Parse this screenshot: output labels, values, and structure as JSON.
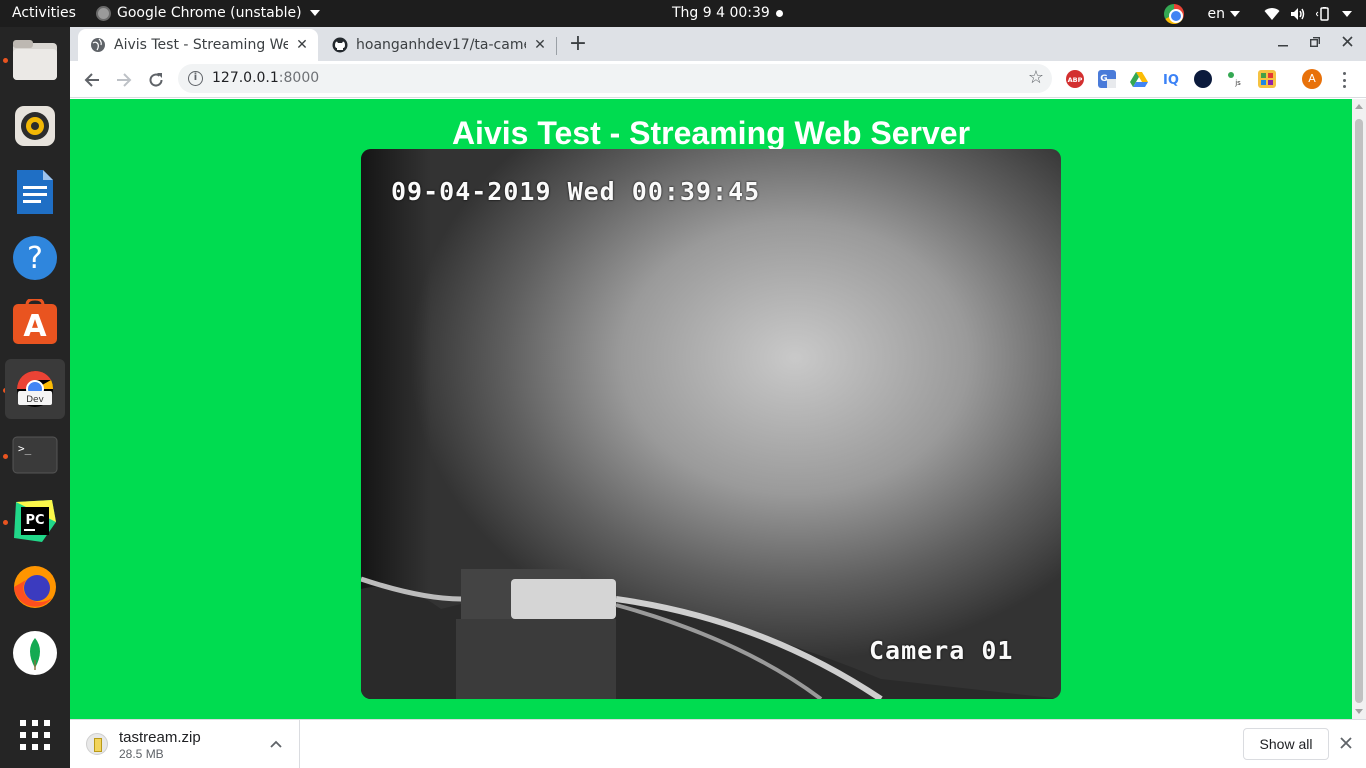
{
  "system_bar": {
    "activities": "Activities",
    "app_name": "Google Chrome (unstable)",
    "clock": "Thg 9 4  00:39",
    "language": "en"
  },
  "dock": {
    "items": [
      {
        "name": "files-icon",
        "running": true
      },
      {
        "name": "rhythmbox-icon",
        "running": false
      },
      {
        "name": "libreoffice-writer-icon",
        "running": false
      },
      {
        "name": "help-icon",
        "running": false
      },
      {
        "name": "software-center-icon",
        "running": false
      },
      {
        "name": "chrome-dev-icon",
        "running": true,
        "label": "Dev"
      },
      {
        "name": "terminal-icon",
        "running": true
      },
      {
        "name": "pycharm-icon",
        "running": true,
        "label": "PC"
      },
      {
        "name": "firefox-icon",
        "running": false
      },
      {
        "name": "mongodb-compass-icon",
        "running": false
      },
      {
        "name": "show-applications-icon",
        "running": false
      }
    ]
  },
  "browser": {
    "tabs": [
      {
        "title": "Aivis Test - Streaming Web Server",
        "active": true
      },
      {
        "title": "hoanganhdev17/ta-camera",
        "active": false
      }
    ],
    "address": {
      "host": "127.0.0.1",
      "port": ":8000"
    },
    "extensions": [
      "adblock-plus-icon",
      "google-translate-icon",
      "google-drive-icon",
      "iq-icon",
      "dark-circle-icon",
      "js-icon",
      "puzzle-extension-icon"
    ],
    "profile_initial": "A"
  },
  "page": {
    "title": "Aivis Test - Streaming Web Server",
    "stream": {
      "timestamp": "09-04-2019 Wed 00:39:45",
      "camera_label": "Camera 01"
    }
  },
  "download_shelf": {
    "file_name": "tastream.zip",
    "file_size": "28.5 MB",
    "show_all": "Show all"
  },
  "colors": {
    "page_background": "#00dc50",
    "page_title": "#ffffff",
    "dock_running_dot": "#e95420"
  }
}
